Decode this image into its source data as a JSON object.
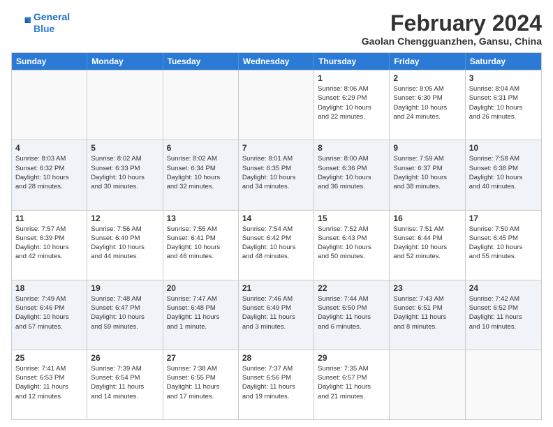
{
  "header": {
    "logo_line1": "General",
    "logo_line2": "Blue",
    "month": "February 2024",
    "location": "Gaolan Chengguanzhen, Gansu, China"
  },
  "weekdays": [
    "Sunday",
    "Monday",
    "Tuesday",
    "Wednesday",
    "Thursday",
    "Friday",
    "Saturday"
  ],
  "rows": [
    [
      {
        "day": "",
        "info": ""
      },
      {
        "day": "",
        "info": ""
      },
      {
        "day": "",
        "info": ""
      },
      {
        "day": "",
        "info": ""
      },
      {
        "day": "1",
        "info": "Sunrise: 8:06 AM\nSunset: 6:29 PM\nDaylight: 10 hours\nand 22 minutes."
      },
      {
        "day": "2",
        "info": "Sunrise: 8:05 AM\nSunset: 6:30 PM\nDaylight: 10 hours\nand 24 minutes."
      },
      {
        "day": "3",
        "info": "Sunrise: 8:04 AM\nSunset: 6:31 PM\nDaylight: 10 hours\nand 26 minutes."
      }
    ],
    [
      {
        "day": "4",
        "info": "Sunrise: 8:03 AM\nSunset: 6:32 PM\nDaylight: 10 hours\nand 28 minutes."
      },
      {
        "day": "5",
        "info": "Sunrise: 8:02 AM\nSunset: 6:33 PM\nDaylight: 10 hours\nand 30 minutes."
      },
      {
        "day": "6",
        "info": "Sunrise: 8:02 AM\nSunset: 6:34 PM\nDaylight: 10 hours\nand 32 minutes."
      },
      {
        "day": "7",
        "info": "Sunrise: 8:01 AM\nSunset: 6:35 PM\nDaylight: 10 hours\nand 34 minutes."
      },
      {
        "day": "8",
        "info": "Sunrise: 8:00 AM\nSunset: 6:36 PM\nDaylight: 10 hours\nand 36 minutes."
      },
      {
        "day": "9",
        "info": "Sunrise: 7:59 AM\nSunset: 6:37 PM\nDaylight: 10 hours\nand 38 minutes."
      },
      {
        "day": "10",
        "info": "Sunrise: 7:58 AM\nSunset: 6:38 PM\nDaylight: 10 hours\nand 40 minutes."
      }
    ],
    [
      {
        "day": "11",
        "info": "Sunrise: 7:57 AM\nSunset: 6:39 PM\nDaylight: 10 hours\nand 42 minutes."
      },
      {
        "day": "12",
        "info": "Sunrise: 7:56 AM\nSunset: 6:40 PM\nDaylight: 10 hours\nand 44 minutes."
      },
      {
        "day": "13",
        "info": "Sunrise: 7:55 AM\nSunset: 6:41 PM\nDaylight: 10 hours\nand 46 minutes."
      },
      {
        "day": "14",
        "info": "Sunrise: 7:54 AM\nSunset: 6:42 PM\nDaylight: 10 hours\nand 48 minutes."
      },
      {
        "day": "15",
        "info": "Sunrise: 7:52 AM\nSunset: 6:43 PM\nDaylight: 10 hours\nand 50 minutes."
      },
      {
        "day": "16",
        "info": "Sunrise: 7:51 AM\nSunset: 6:44 PM\nDaylight: 10 hours\nand 52 minutes."
      },
      {
        "day": "17",
        "info": "Sunrise: 7:50 AM\nSunset: 6:45 PM\nDaylight: 10 hours\nand 55 minutes."
      }
    ],
    [
      {
        "day": "18",
        "info": "Sunrise: 7:49 AM\nSunset: 6:46 PM\nDaylight: 10 hours\nand 57 minutes."
      },
      {
        "day": "19",
        "info": "Sunrise: 7:48 AM\nSunset: 6:47 PM\nDaylight: 10 hours\nand 59 minutes."
      },
      {
        "day": "20",
        "info": "Sunrise: 7:47 AM\nSunset: 6:48 PM\nDaylight: 11 hours\nand 1 minute."
      },
      {
        "day": "21",
        "info": "Sunrise: 7:46 AM\nSunset: 6:49 PM\nDaylight: 11 hours\nand 3 minutes."
      },
      {
        "day": "22",
        "info": "Sunrise: 7:44 AM\nSunset: 6:50 PM\nDaylight: 11 hours\nand 6 minutes."
      },
      {
        "day": "23",
        "info": "Sunrise: 7:43 AM\nSunset: 6:51 PM\nDaylight: 11 hours\nand 8 minutes."
      },
      {
        "day": "24",
        "info": "Sunrise: 7:42 AM\nSunset: 6:52 PM\nDaylight: 11 hours\nand 10 minutes."
      }
    ],
    [
      {
        "day": "25",
        "info": "Sunrise: 7:41 AM\nSunset: 6:53 PM\nDaylight: 11 hours\nand 12 minutes."
      },
      {
        "day": "26",
        "info": "Sunrise: 7:39 AM\nSunset: 6:54 PM\nDaylight: 11 hours\nand 14 minutes."
      },
      {
        "day": "27",
        "info": "Sunrise: 7:38 AM\nSunset: 6:55 PM\nDaylight: 11 hours\nand 17 minutes."
      },
      {
        "day": "28",
        "info": "Sunrise: 7:37 AM\nSunset: 6:56 PM\nDaylight: 11 hours\nand 19 minutes."
      },
      {
        "day": "29",
        "info": "Sunrise: 7:35 AM\nSunset: 6:57 PM\nDaylight: 11 hours\nand 21 minutes."
      },
      {
        "day": "",
        "info": ""
      },
      {
        "day": "",
        "info": ""
      }
    ]
  ]
}
